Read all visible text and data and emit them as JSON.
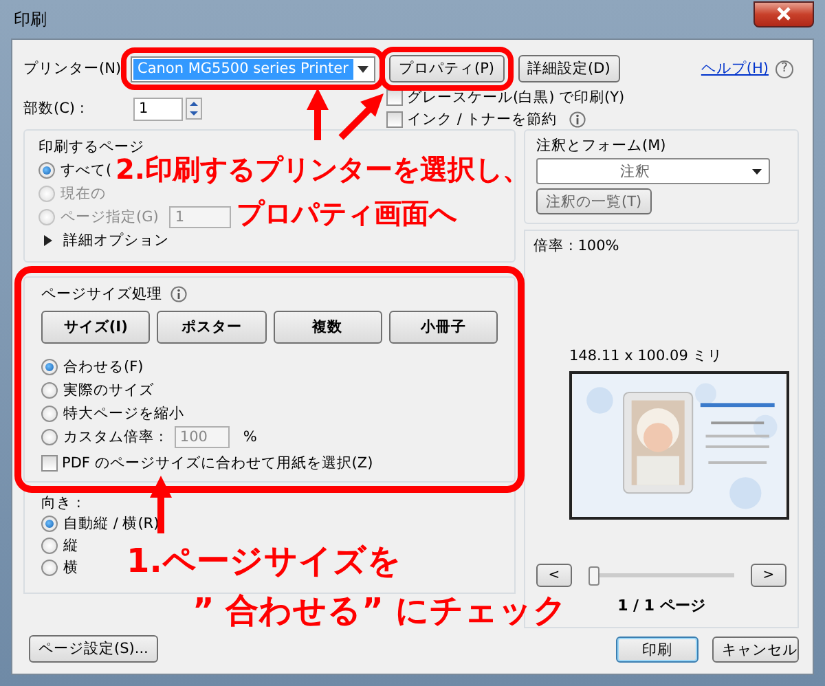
{
  "window": {
    "title": "印刷"
  },
  "printer": {
    "label": "プリンター(N)",
    "value": "Canon MG5500 series Printer"
  },
  "top_buttons": [
    {
      "label": "プロパティ(P)"
    },
    {
      "label": "詳細設定(D)"
    }
  ],
  "help_link": "ヘルプ(H)",
  "help_icon": "?",
  "copies": {
    "label": "部数(C) :",
    "value": "1"
  },
  "options": [
    {
      "label": "グレースケール(白黒) で印刷(Y)",
      "checked": false
    },
    {
      "label": "インク / トナーを節約",
      "checked": false
    }
  ],
  "pages_group": {
    "title": "印刷するページ",
    "radios": [
      {
        "label": "すべて(",
        "selected": true,
        "disabled": false
      },
      {
        "label": "現在の",
        "selected": false,
        "disabled": true
      },
      {
        "label": "ページ指定(G)",
        "selected": false,
        "disabled": true,
        "value": "1"
      }
    ],
    "more": "詳細オプション"
  },
  "size_group": {
    "title": "ページサイズ処理",
    "buttons": [
      "サイズ(I)",
      "ポスター",
      "複数",
      "小冊子"
    ],
    "radios": [
      {
        "label": "合わせる(F)",
        "selected": true
      },
      {
        "label": "実際のサイズ",
        "selected": false
      },
      {
        "label": "特大ページを縮小",
        "selected": false
      },
      {
        "label": "カスタム倍率 :",
        "selected": false,
        "value": "100",
        "unit": "%"
      }
    ],
    "pdf_option": {
      "label": "PDF のページサイズに合わせて用紙を選択(Z)",
      "checked": false
    }
  },
  "orientation": {
    "title": "向き :",
    "radios": [
      {
        "label": "自動縦 / 横(R)",
        "selected": true
      },
      {
        "label": "縦",
        "selected": false
      },
      {
        "label": "横",
        "selected": false
      }
    ]
  },
  "page_setup_button": "ページ設定(S)...",
  "annotations_forms": {
    "title": "注釈とフォーム(M)",
    "value": "注釈",
    "button": "注釈の一覧(T)"
  },
  "scale": "倍率 : 100%",
  "paper_size": "148.11 x 100.09 ミリ",
  "nav": {
    "prev": "<",
    "next": ">",
    "level": 0,
    "page": "1 / 1 ページ"
  },
  "buttons": [
    {
      "label": "印刷",
      "default": true
    },
    {
      "label": "キャンセル",
      "default": false
    }
  ],
  "callouts": [
    {
      "lines": [
        "2.印刷するプリンターを選択し、",
        "プロパティ画面へ"
      ]
    },
    {
      "lines": [
        "1.ページサイズを",
        "” 合わせる” にチェック"
      ]
    }
  ]
}
